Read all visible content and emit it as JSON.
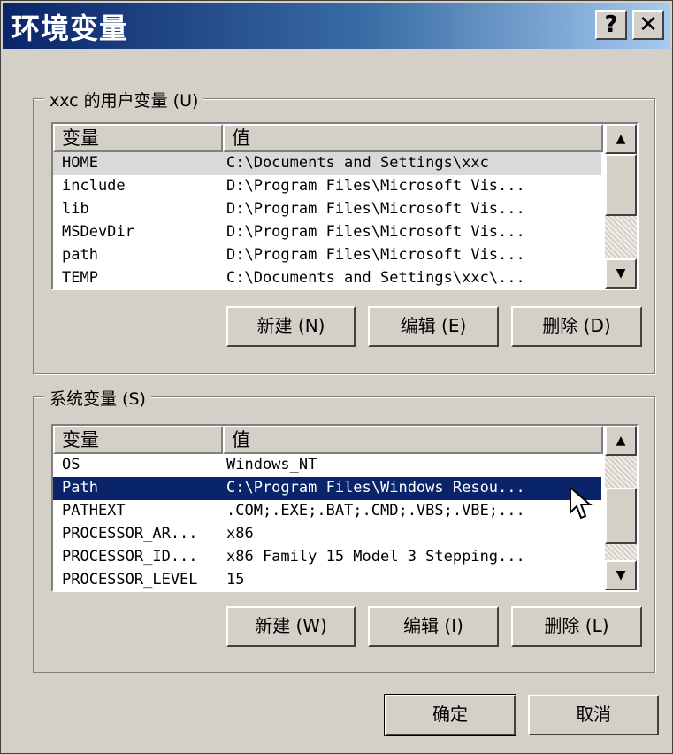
{
  "window": {
    "title": "环境变量",
    "help_glyph": "?",
    "close_glyph": "✕"
  },
  "user_vars": {
    "label": "xxc 的用户变量 (U)",
    "columns": [
      "变量",
      "值"
    ],
    "rows": [
      {
        "name": "HOME",
        "value": "C:\\Documents and Settings\\xxc"
      },
      {
        "name": "include",
        "value": "D:\\Program Files\\Microsoft Vis..."
      },
      {
        "name": "lib",
        "value": "D:\\Program Files\\Microsoft Vis..."
      },
      {
        "name": "MSDevDir",
        "value": "D:\\Program Files\\Microsoft Vis..."
      },
      {
        "name": "path",
        "value": "D:\\Program Files\\Microsoft Vis..."
      },
      {
        "name": "TEMP",
        "value": "C:\\Documents and Settings\\xxc\\..."
      }
    ],
    "buttons": {
      "new": "新建 (N)",
      "edit": "编辑 (E)",
      "delete": "删除 (D)"
    }
  },
  "system_vars": {
    "label": "系统变量 (S)",
    "columns": [
      "变量",
      "值"
    ],
    "rows": [
      {
        "name": "OS",
        "value": "Windows_NT"
      },
      {
        "name": "Path",
        "value": "C:\\Program Files\\Windows Resou..."
      },
      {
        "name": "PATHEXT",
        "value": ".COM;.EXE;.BAT;.CMD;.VBS;.VBE;..."
      },
      {
        "name": "PROCESSOR_AR...",
        "value": "x86"
      },
      {
        "name": "PROCESSOR_ID...",
        "value": "x86 Family 15 Model 3 Stepping..."
      },
      {
        "name": "PROCESSOR_LEVEL",
        "value": "15"
      }
    ],
    "selected_index": 1,
    "buttons": {
      "new": "新建 (W)",
      "edit": "编辑 (I)",
      "delete": "删除 (L)"
    }
  },
  "footer": {
    "ok": "确定",
    "cancel": "取消"
  },
  "colors": {
    "title_start": "#0a246a",
    "title_end": "#a6caf0",
    "selection": "#0a246a",
    "face": "#d4d0c8"
  }
}
